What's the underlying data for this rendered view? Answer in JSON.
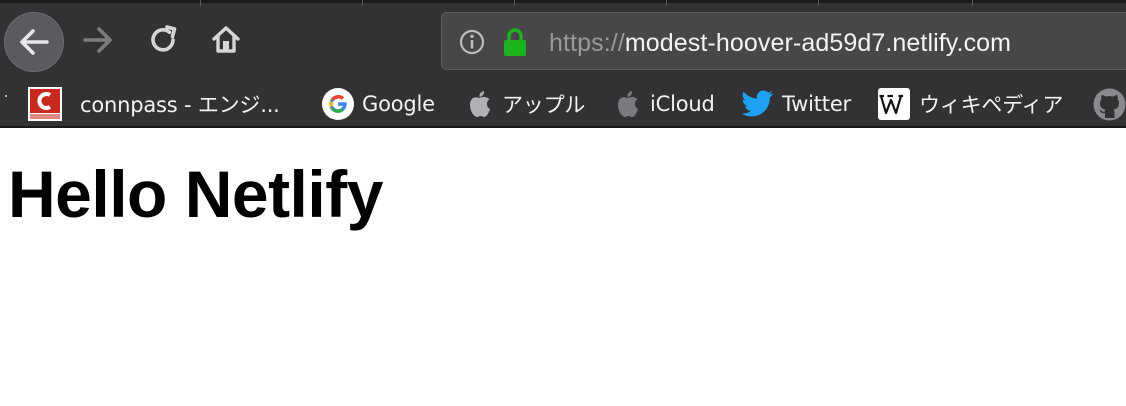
{
  "toolbar": {
    "back_icon": "arrow-left-icon",
    "forward_icon": "arrow-right-icon",
    "reload_icon": "reload-icon",
    "home_icon": "home-icon"
  },
  "urlbar": {
    "scheme": "https://",
    "host": "modest-hoover-ad59d7.netlify.com",
    "info_icon": "info-icon",
    "lock_icon": "lock-icon",
    "lock_color": "#1db31d"
  },
  "bookmarks": [
    {
      "label": "connpass - エンジ...",
      "icon": "connpass-icon"
    },
    {
      "label": "Google",
      "icon": "google-icon"
    },
    {
      "label": "アップル",
      "icon": "apple-icon"
    },
    {
      "label": "iCloud",
      "icon": "apple-icon"
    },
    {
      "label": "Twitter",
      "icon": "twitter-bird-icon"
    },
    {
      "label": "ウィキペディア",
      "icon": "wikipedia-icon"
    }
  ],
  "page": {
    "heading": "Hello Netlify"
  },
  "colors": {
    "toolbar_bg": "#323234",
    "urlbar_bg": "#474749",
    "twitter_blue": "#1da1f2",
    "connpass_red": "#c9281f"
  }
}
